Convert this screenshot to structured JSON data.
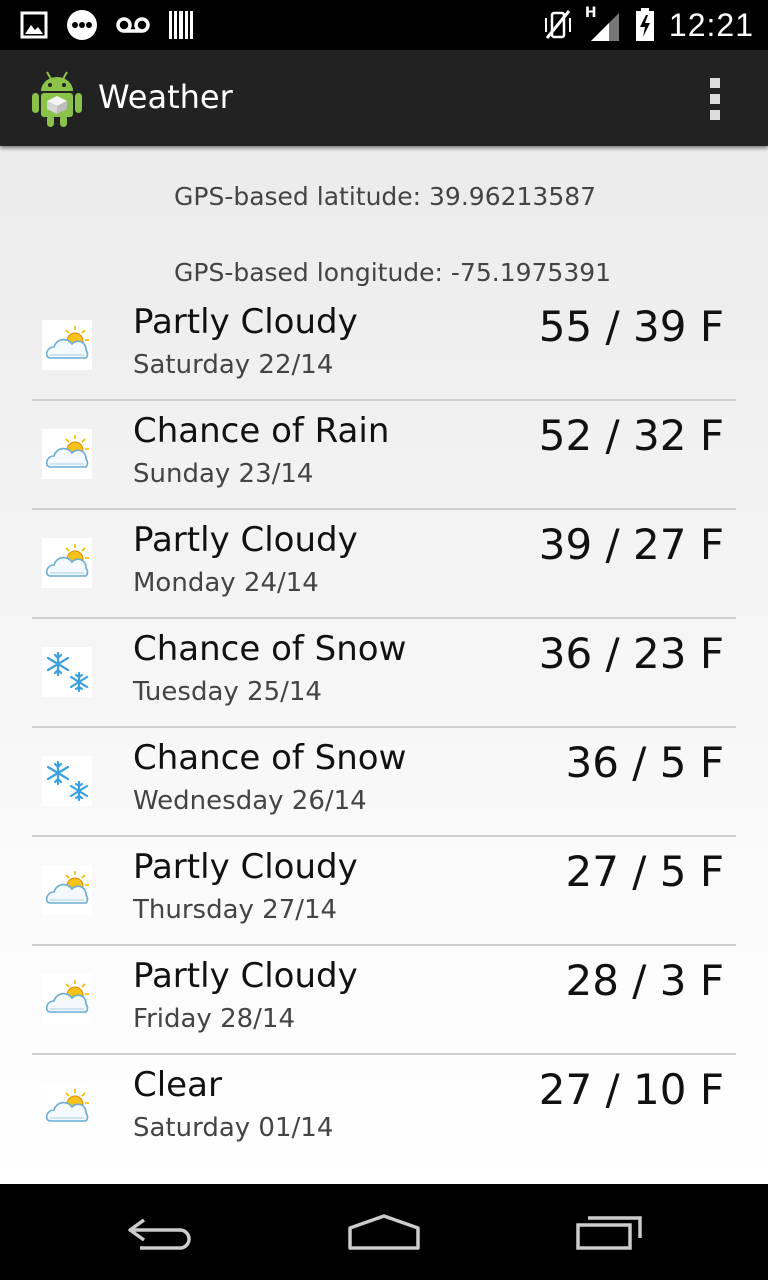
{
  "status_bar": {
    "icons_left": [
      "image-notification-icon",
      "chat-bubble-icon",
      "voicemail-icon",
      "barcode-icon"
    ],
    "icons_right": [
      "vibrate-icon",
      "signal-icon",
      "battery-icon"
    ],
    "network_type": "H",
    "time": "12:21"
  },
  "action_bar": {
    "title": "Weather",
    "app_icon": "android-robot-icon",
    "overflow_icon": "overflow-menu-icon"
  },
  "gps": {
    "latitude_text": "GPS-based latitude: 39.96213587",
    "longitude_text": "GPS-based longitude: -75.1975391"
  },
  "forecast": [
    {
      "condition": "Partly Cloudy",
      "date": "Saturday 22/14",
      "temp": "55 / 39 F",
      "icon": "partly-cloudy-icon"
    },
    {
      "condition": "Chance of Rain",
      "date": "Sunday 23/14",
      "temp": "52 / 32 F",
      "icon": "partly-cloudy-icon"
    },
    {
      "condition": "Partly Cloudy",
      "date": "Monday 24/14",
      "temp": "39 / 27 F",
      "icon": "partly-cloudy-icon"
    },
    {
      "condition": "Chance of Snow",
      "date": "Tuesday 25/14",
      "temp": "36 / 23 F",
      "icon": "snowflake-icon"
    },
    {
      "condition": "Chance of Snow",
      "date": "Wednesday 26/14",
      "temp": "36 / 5 F",
      "icon": "snowflake-icon"
    },
    {
      "condition": "Partly Cloudy",
      "date": "Thursday 27/14",
      "temp": "27 / 5 F",
      "icon": "partly-cloudy-icon"
    },
    {
      "condition": "Partly Cloudy",
      "date": "Friday 28/14",
      "temp": "28 / 3 F",
      "icon": "partly-cloudy-icon"
    },
    {
      "condition": "Clear",
      "date": "Saturday 01/14",
      "temp": "27 / 10 F",
      "icon": "partly-cloudy-icon"
    }
  ],
  "nav_bar": {
    "back_icon": "back-icon",
    "home_icon": "home-icon",
    "recents_icon": "recent-apps-icon"
  },
  "colors": {
    "status_bar_bg": "#000000",
    "action_bar_bg": "#222222",
    "snow_blue": "#3aa0e0",
    "sun_yellow": "#f5b800"
  }
}
